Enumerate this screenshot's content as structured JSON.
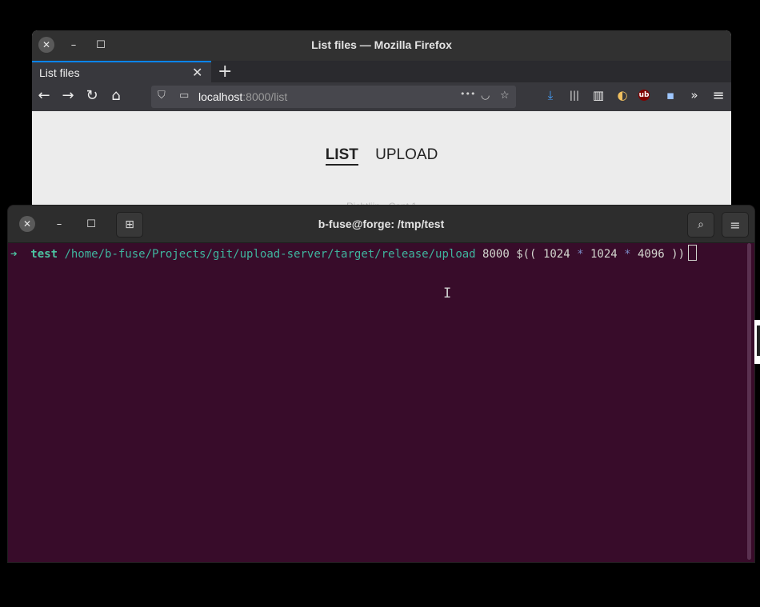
{
  "firefox": {
    "window_title": "List files — Mozilla Firefox",
    "tab_label": "List files",
    "url_host": "localhost",
    "url_rest": ":8000/list",
    "nav": {
      "list": "LIST",
      "upload": "UPLOAD"
    },
    "faint_text": "Richtlijn · Cont.1"
  },
  "terminal": {
    "title": "b-fuse@forge: /tmp/test",
    "prompt_arrow": "➜",
    "prompt_dir": "test",
    "command_path": "/home/b-fuse/Projects/git/upload-server/target/release/upload",
    "arg_port": "8000",
    "arg_expr_open": "$((",
    "arg_a": "1024",
    "op1": "*",
    "arg_b": "1024",
    "op2": "*",
    "arg_c": "4096",
    "arg_expr_close": "))"
  },
  "icons": {
    "window_close": "✕",
    "window_min": "–",
    "window_max": "☐",
    "tab_close": "✕",
    "new_tab": "+",
    "back": "←",
    "forward": "→",
    "reload": "↻",
    "home": "⌂",
    "shield": "⛉",
    "page": "▭",
    "more": "•••",
    "pocket": "◡",
    "star": "☆",
    "download": "⤓",
    "library": "|||",
    "sidebar": "▥",
    "ext1": "◐",
    "ubo": "ub",
    "ext2": "▪",
    "overflow": "»",
    "menu": "≡",
    "new_terminal_tab": "⊞",
    "search": "⌕",
    "hamburger": "≡",
    "ibeam": "I"
  }
}
